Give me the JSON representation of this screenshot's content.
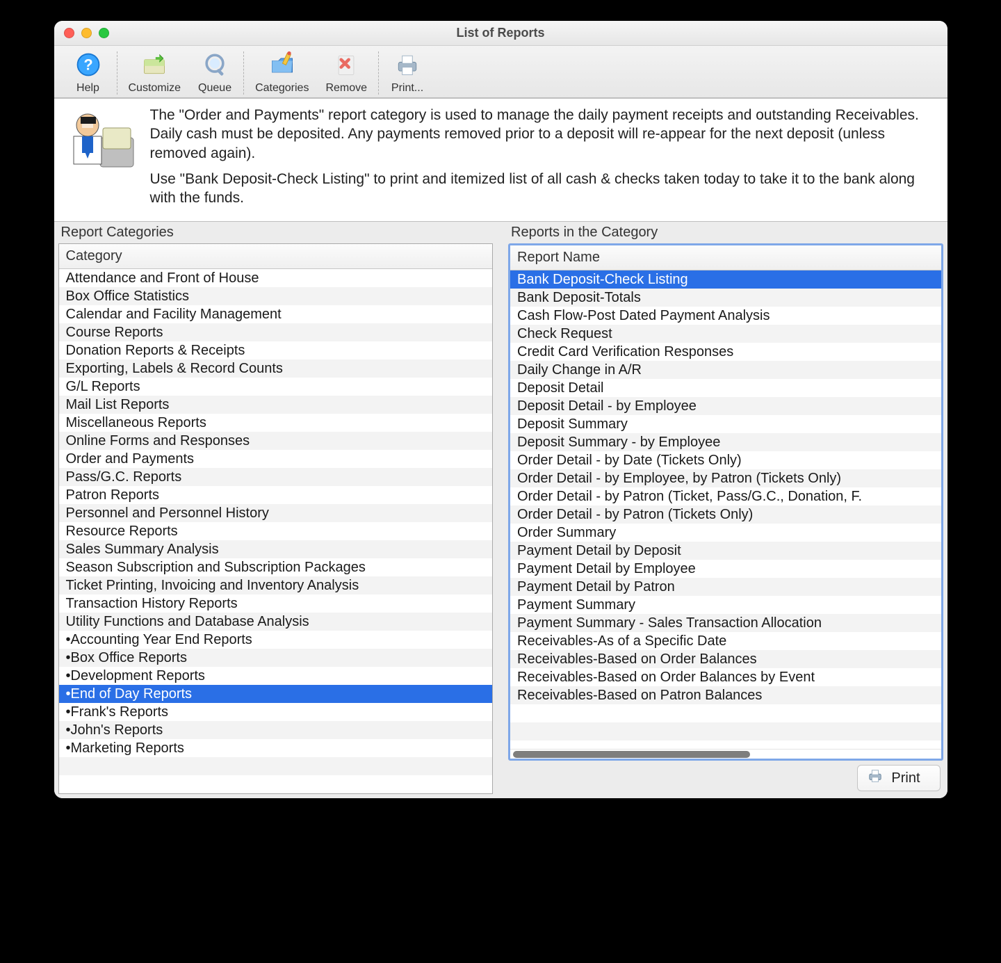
{
  "window": {
    "title": "List of Reports"
  },
  "toolbar": {
    "help": {
      "label": "Help",
      "icon": "help-icon"
    },
    "customize": {
      "label": "Customize",
      "icon": "customize-icon"
    },
    "queue": {
      "label": "Queue",
      "icon": "queue-icon"
    },
    "categories": {
      "label": "Categories",
      "icon": "folder-pencil-icon"
    },
    "remove": {
      "label": "Remove",
      "icon": "remove-icon"
    },
    "print": {
      "label": "Print...",
      "icon": "printer-icon"
    }
  },
  "description": {
    "p1": "The \"Order and Payments\" report category is used to manage the daily payment receipts and outstanding Receivables.  Daily cash must be deposited.  Any payments removed prior to a deposit will re-appear for the next deposit (unless removed again).",
    "p2": "Use \"Bank Deposit-Check Listing\" to print and itemized list of all cash & checks taken today to take it to the bank along with the funds."
  },
  "left_pane": {
    "title": "Report Categories",
    "column": "Category",
    "selected_index": 23,
    "items": [
      "Attendance and Front of House",
      "Box Office Statistics",
      "Calendar and Facility Management",
      "Course Reports",
      "Donation Reports & Receipts",
      "Exporting, Labels & Record Counts",
      "G/L Reports",
      "Mail List Reports",
      "Miscellaneous Reports",
      "Online Forms and Responses",
      "Order and Payments",
      "Pass/G.C. Reports",
      "Patron Reports",
      "Personnel and Personnel History",
      "Resource Reports",
      "Sales Summary Analysis",
      "Season Subscription and Subscription Packages",
      "Ticket Printing, Invoicing and Inventory Analysis",
      "Transaction History Reports",
      "Utility Functions and Database Analysis",
      "•Accounting Year End Reports",
      "•Box Office Reports",
      "•Development Reports",
      "•End of Day Reports",
      "•Frank's Reports",
      "•John's Reports",
      "•Marketing Reports"
    ]
  },
  "right_pane": {
    "title": "Reports in the Category",
    "column": "Report Name",
    "selected_index": 0,
    "items": [
      "Bank Deposit-Check Listing",
      "Bank Deposit-Totals",
      "Cash Flow-Post Dated Payment Analysis",
      "Check Request",
      "Credit Card Verification Responses",
      "Daily Change in A/R",
      "Deposit Detail",
      "Deposit Detail - by Employee",
      "Deposit Summary",
      "Deposit Summary - by Employee",
      "Order Detail - by Date (Tickets Only)",
      "Order Detail - by Employee, by Patron (Tickets Only)",
      "Order Detail - by Patron (Ticket, Pass/G.C., Donation, F.",
      "Order Detail - by Patron (Tickets Only)",
      "Order Summary",
      "Payment Detail by Deposit",
      "Payment Detail by Employee",
      "Payment Detail by Patron",
      "Payment Summary",
      "Payment Summary - Sales Transaction Allocation",
      "Receivables-As of a Specific Date",
      "Receivables-Based on Order Balances",
      "Receivables-Based on Order Balances by Event",
      "Receivables-Based on Patron Balances"
    ]
  },
  "footer": {
    "print_label": "Print"
  }
}
